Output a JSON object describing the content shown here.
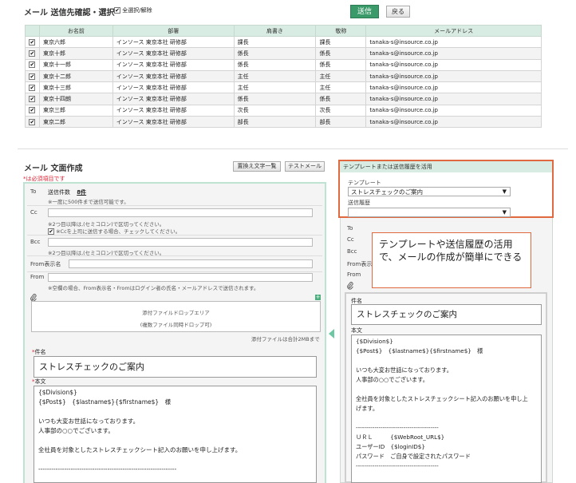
{
  "top": {
    "title": "メール 送信先確認・選択",
    "select_all_label": "全選択/解除",
    "send_label": "送信",
    "back_label": "戻る"
  },
  "table": {
    "headers": [
      "お名前",
      "部署",
      "肩書き",
      "敬称",
      "メールアドレス"
    ],
    "rows": [
      {
        "name": "東京六郎",
        "dept": "インソース 東京本社 研修部",
        "title": "課長",
        "honorific": "課長",
        "email": "tanaka-s@insource.co.jp"
      },
      {
        "name": "東京十郎",
        "dept": "インソース 東京本社 研修部",
        "title": "係長",
        "honorific": "係長",
        "email": "tanaka-s@insource.co.jp"
      },
      {
        "name": "東京十一郎",
        "dept": "インソース 東京本社 研修部",
        "title": "係長",
        "honorific": "係長",
        "email": "tanaka-s@insource.co.jp"
      },
      {
        "name": "東京十二郎",
        "dept": "インソース 東京本社 研修部",
        "title": "主任",
        "honorific": "主任",
        "email": "tanaka-s@insource.co.jp"
      },
      {
        "name": "東京十三郎",
        "dept": "インソース 東京本社 研修部",
        "title": "主任",
        "honorific": "主任",
        "email": "tanaka-s@insource.co.jp"
      },
      {
        "name": "東京十四朗",
        "dept": "インソース 東京本社 研修部",
        "title": "係長",
        "honorific": "係長",
        "email": "tanaka-s@insource.co.jp"
      },
      {
        "name": "東京三郎",
        "dept": "インソース 東京本社 研修部",
        "title": "次長",
        "honorific": "次長",
        "email": "tanaka-s@insource.co.jp"
      },
      {
        "name": "東京二郎",
        "dept": "インソース 東京本社 研修部",
        "title": "部長",
        "honorific": "部長",
        "email": "tanaka-s@insource.co.jp"
      }
    ]
  },
  "compose": {
    "title": "メール 文面作成",
    "required_note": "*は必須項目です",
    "replace_button": "置換え文字一覧",
    "test_mail_button": "テストメール",
    "to_label": "To",
    "to_count_label": "送信件数",
    "to_count": "8件",
    "to_note": "※一度に500件まで送信可能です。",
    "cc_label": "Cc",
    "cc_note": "※2つ目以降は,(セミコロン)で区切ってください。",
    "cc_check_label": "※Ccを上司に送信する場合、チェックしてください。",
    "bcc_label": "Bcc",
    "bcc_note": "※2つ目以降は,(セミコロン)で区切ってください。",
    "from_name_label": "From表示名",
    "from_label": "From",
    "from_note": "※空欄の場合、From表示名・Fromはログイン者の氏名・メールアドレスで送信されます。",
    "attach_line1": "添付ファイルドロップエリア",
    "attach_line2": "(複数ファイル同時ドロップ可)",
    "attach_limit": "添付ファイルは合計2MBまで",
    "subject_label": "件名",
    "subject_value": "ストレスチェックのご案内",
    "body_label": "本文",
    "body_lines": [
      "{$Division$}",
      "{$Post$}　{$lastname$}{$firstname$}　様",
      "",
      "いつも大変お世話になっております。",
      "人事部の○○でございます。",
      "",
      "全社員を対象としたストレスチェックシート記入のお願いを申し上げます。",
      "",
      "----------------------------------------------------------------"
    ]
  },
  "template_panel": {
    "header": "テンプレートまたは送信履歴を活用",
    "template_label": "テンプレート",
    "template_value": "ストレスチェックのご案内",
    "history_label": "送信履歴",
    "history_value": ""
  },
  "preview": {
    "to_label": "To",
    "cc_label": "Cc",
    "bcc_label": "Bcc",
    "from_name_label": "From表示",
    "from_label": "From",
    "subject_label": "件名",
    "subject_value": "ストレスチェックのご案内",
    "body_label": "本文",
    "body_lines": [
      "{$Division$}",
      "{$Post$}　{$lastname$}{$firstname$}　様",
      "",
      "いつも大変お世話になっております。",
      "人事部の○○でございます。",
      "",
      "全社員を対象としたストレスチェックシート記入のお願いを申し上",
      "げます。",
      "",
      "----------------------------------------",
      "ＵＲＬ　　　{$WebRoot_URL$}",
      "ユーザーID　{$loginID$}",
      "パスワード　ご自身で設定されたパスワード",
      "----------------------------------------"
    ]
  },
  "callout": {
    "text": "テンプレートや送信履歴の活用で、メールの作成が簡単にできる"
  },
  "colors": {
    "accent": "#3a9a6a",
    "header_bg": "#d9ece3",
    "callout_border": "#e0693f"
  }
}
